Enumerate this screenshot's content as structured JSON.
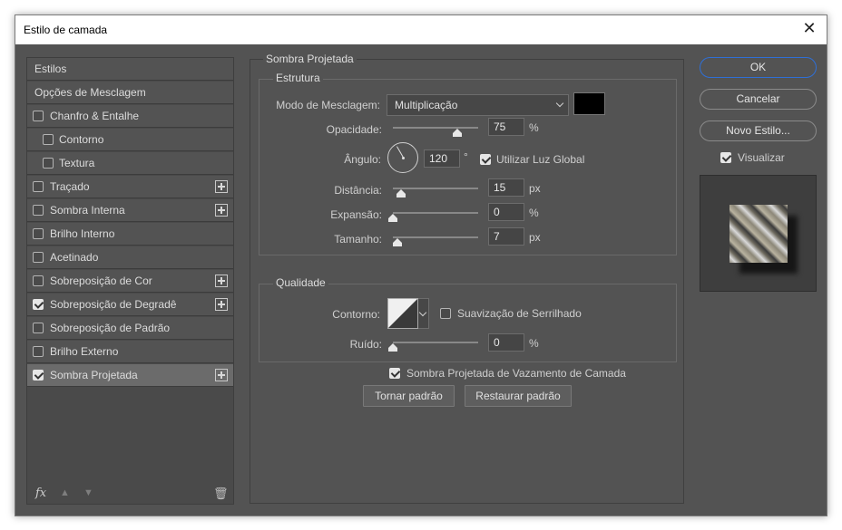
{
  "window": {
    "title": "Estilo de camada",
    "close_glyph": "✕"
  },
  "left_panel": {
    "items": [
      {
        "label": "Estilos",
        "checkbox": false,
        "checked": false,
        "indent": false,
        "plus": false,
        "selected": false
      },
      {
        "label": "Opções de Mesclagem",
        "checkbox": false,
        "checked": false,
        "indent": false,
        "plus": false,
        "selected": false
      },
      {
        "label": "Chanfro & Entalhe",
        "checkbox": true,
        "checked": false,
        "indent": false,
        "plus": false,
        "selected": false
      },
      {
        "label": "Contorno",
        "checkbox": true,
        "checked": false,
        "indent": true,
        "plus": false,
        "selected": false
      },
      {
        "label": "Textura",
        "checkbox": true,
        "checked": false,
        "indent": true,
        "plus": false,
        "selected": false
      },
      {
        "label": "Traçado",
        "checkbox": true,
        "checked": false,
        "indent": false,
        "plus": true,
        "selected": false
      },
      {
        "label": "Sombra Interna",
        "checkbox": true,
        "checked": false,
        "indent": false,
        "plus": true,
        "selected": false
      },
      {
        "label": "Brilho Interno",
        "checkbox": true,
        "checked": false,
        "indent": false,
        "plus": false,
        "selected": false
      },
      {
        "label": "Acetinado",
        "checkbox": true,
        "checked": false,
        "indent": false,
        "plus": false,
        "selected": false
      },
      {
        "label": "Sobreposição de Cor",
        "checkbox": true,
        "checked": false,
        "indent": false,
        "plus": true,
        "selected": false
      },
      {
        "label": "Sobreposição de Degradê",
        "checkbox": true,
        "checked": true,
        "indent": false,
        "plus": true,
        "selected": false
      },
      {
        "label": "Sobreposição de Padrão",
        "checkbox": true,
        "checked": false,
        "indent": false,
        "plus": false,
        "selected": false
      },
      {
        "label": "Brilho Externo",
        "checkbox": true,
        "checked": false,
        "indent": false,
        "plus": false,
        "selected": false
      },
      {
        "label": "Sombra Projetada",
        "checkbox": true,
        "checked": true,
        "indent": false,
        "plus": true,
        "selected": true
      }
    ],
    "bottom": {
      "fx_label": "fx",
      "up_glyph": "▲",
      "down_glyph": "▼",
      "trash_glyph": "🗑"
    }
  },
  "main": {
    "section_title": "Sombra Projetada",
    "structure": {
      "legend": "Estrutura",
      "blend_mode_label": "Modo de Mesclagem:",
      "blend_mode_value": "Multiplicação",
      "shadow_color": "#000000",
      "opacity_label": "Opacidade:",
      "opacity_value": "75",
      "opacity_unit": "%",
      "opacity_fraction": 0.75,
      "angle_label": "Ângulo:",
      "angle_value": "120",
      "angle_unit": "°",
      "global_light_label": "Utilizar Luz Global",
      "global_light_checked": true,
      "distance_label": "Distância:",
      "distance_value": "15",
      "distance_unit": "px",
      "distance_fraction": 0.1,
      "spread_label": "Expansão:",
      "spread_value": "0",
      "spread_unit": "%",
      "spread_fraction": 0.0,
      "size_label": "Tamanho:",
      "size_value": "7",
      "size_unit": "px",
      "size_fraction": 0.05
    },
    "quality": {
      "legend": "Qualidade",
      "contour_label": "Contorno:",
      "antialias_label": "Suavização de Serrilhado",
      "antialias_checked": false,
      "noise_label": "Ruído:",
      "noise_value": "0",
      "noise_unit": "%",
      "noise_fraction": 0.0
    },
    "knockout_label": "Sombra Projetada de Vazamento de Camada",
    "knockout_checked": true,
    "make_default_label": "Tornar padrão",
    "reset_default_label": "Restaurar padrão"
  },
  "right": {
    "ok_label": "OK",
    "cancel_label": "Cancelar",
    "new_style_label": "Novo Estilo...",
    "preview_label": "Visualizar",
    "preview_checked": true
  },
  "colors": {
    "accent": "#2f6fd6",
    "panel": "#535353",
    "selected_item": "#6b6b6b"
  }
}
